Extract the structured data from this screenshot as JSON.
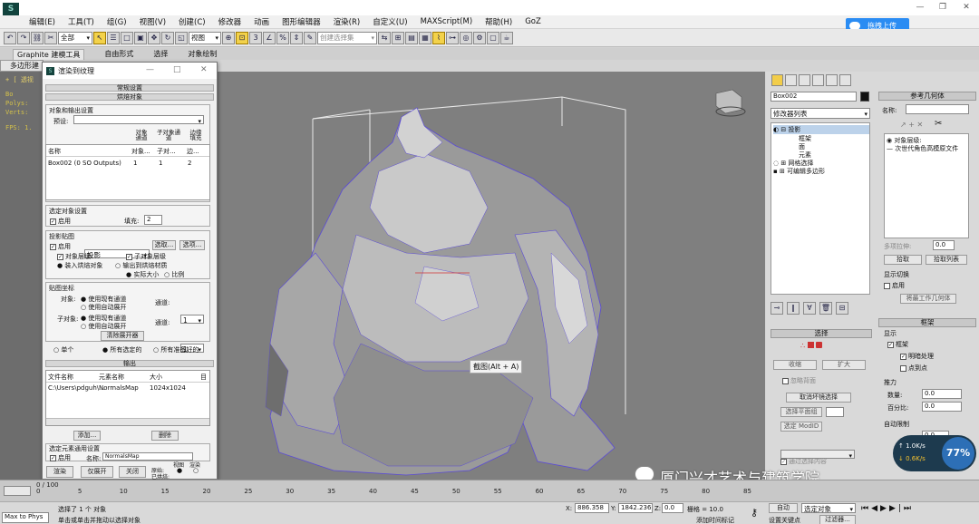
{
  "app": {
    "logo": "S"
  },
  "menubar": {
    "items": [
      "编辑(E)",
      "工具(T)",
      "组(G)",
      "视图(V)",
      "创建(C)",
      "修改器",
      "动画",
      "图形编辑器",
      "渲染(R)",
      "自定义(U)",
      "MAXScript(M)",
      "帮助(H)",
      "GoZ"
    ]
  },
  "upload_button": {
    "label": "拖拽上传"
  },
  "toolbar": {
    "filter_select": "全部",
    "view_select": "视图",
    "named_selection": "创建选择集"
  },
  "ribbon_tabs": [
    "Graphite 建模工具",
    "自由形式",
    "选择",
    "对象绘制"
  ],
  "subtab": {
    "label": "多边形建"
  },
  "viewport": {
    "label": "+ [ 透视",
    "stats": [
      "Bo",
      "Polys:",
      "Verts:",
      "FPS: 1."
    ],
    "tooltip": "截图(Alt + A)"
  },
  "dialog": {
    "title": "渲染到纹理",
    "sections": {
      "general": "常规设置",
      "objects": "烘焙对象",
      "output": "输出"
    },
    "object_output_group": "对象和输出设置",
    "preset_label": "预设:",
    "table_headers": [
      "名称",
      "对象...",
      "子对...",
      "边..."
    ],
    "top_headers": [
      "对象通道",
      "子对象通道",
      "边缘填充"
    ],
    "table_rows": [
      [
        "Box002 (0 SO Outputs)",
        "1",
        "1",
        "2"
      ]
    ],
    "selected_settings": {
      "group": "选定对象设置",
      "enabled": "启用",
      "padding_label": "填充:",
      "padding_value": "2"
    },
    "projection": {
      "group": "投影贴图",
      "enabled": "启用",
      "type": "投影",
      "pick": "选取...",
      "options": "选项...",
      "obj_level": "对象层级",
      "sub_level": "子对象层级",
      "bake_obj": "装入烘焙对象",
      "output_bake": "输出到烘焙材质",
      "actual_size": "实际大小",
      "proportion": "比例"
    },
    "mapping": {
      "group": "贴图坐标",
      "object_label": "对象:",
      "subobject_label": "子对象:",
      "use_existing": "使用现有通道",
      "use_auto": "使用自动展开",
      "channel_label": "通道:",
      "channel_value": "1",
      "clear_unwrap": "清除展开器"
    },
    "scope": {
      "single": "单个",
      "all_selected": "所有选定的",
      "all_prepared": "所有准备好的"
    },
    "output_headers": [
      "文件名称",
      "元素名称",
      "大小",
      "目"
    ],
    "output_rows": [
      [
        "C:\\Users\\pdguh\\...",
        "NormalsMap",
        "1024x1024"
      ]
    ],
    "add_button": "添加...",
    "delete_button": "删除",
    "selected_element": {
      "group": "选定元素通用设置",
      "enabled": "启用",
      "name_label": "名称:",
      "name_value": "NormalsMap"
    },
    "buttons": {
      "render": "渲染",
      "unwrap_only": "仅展开",
      "close": "关闭",
      "original": "原始:",
      "baked": "已烘焙:",
      "views": "视图",
      "render_label": "渲染"
    }
  },
  "right_panel": {
    "object_name": "Box002",
    "modifier_list": "修改器列表",
    "stack": [
      "投影",
      "框架",
      "面",
      "元素",
      "网格选择",
      "可编辑多边形"
    ],
    "ref_geom": {
      "title": "参考几何体",
      "name_label": "名称:",
      "obj_level": "对象层级:",
      "obj_name": "次世代角色高模原文件"
    },
    "multi_level": {
      "label": "多项拉伸:",
      "value": "0.0",
      "pick": "拾取",
      "pick_list": "拾取列表"
    },
    "display_switch": {
      "title": "显示切换",
      "enabled": "启用",
      "btn": "将最工作几何体"
    },
    "selection": {
      "title": "选择",
      "shrink": "收缩",
      "grow": "扩大",
      "ignore_back": "忽略背面",
      "clear_bad": "取消坏镜选择",
      "select_by_id": "选择平面组",
      "select_by_mat": "选定 ModID",
      "apply_ext": "通过选择内容"
    },
    "cage": {
      "title": "框架",
      "display_label": "显示",
      "frame": "框架",
      "shaded": "明暗处理",
      "points": "点到点"
    },
    "push": {
      "title": "推力",
      "amount": "数量:",
      "amount_val": "0.0",
      "percent": "百分比:",
      "percent_val": "0.0"
    },
    "auto_wrap": {
      "title": "自动限制",
      "value": "0.0"
    }
  },
  "status": {
    "selected_count": "选择了 1 个 对象",
    "hint": "单击或单击并拖动以选择对象",
    "x_label": "X:",
    "x_value": "886.358",
    "y_label": "Y:",
    "y_value": "1842.236",
    "z_label": "Z:",
    "z_value": "0.0",
    "grid": "栅格 = 10.0",
    "add_time_tag": "添加时间标记",
    "auto_key": "自动",
    "set_key": "设置关键点",
    "selected": "选定对象",
    "filters": "过滤器...",
    "maxtophys": "Max to Phys",
    "timeline_ticks": [
      "0",
      "5",
      "10",
      "15",
      "20",
      "25",
      "30",
      "35",
      "40",
      "45",
      "50",
      "55",
      "60",
      "65",
      "70",
      "75",
      "80",
      "85"
    ],
    "frame_label": "0 / 100"
  },
  "watermark": {
    "text": "厦门兴才艺术与建筑学院"
  },
  "perf_widget": {
    "percent": "77%",
    "up": "1.0K/s",
    "down": "0.6K/s"
  }
}
